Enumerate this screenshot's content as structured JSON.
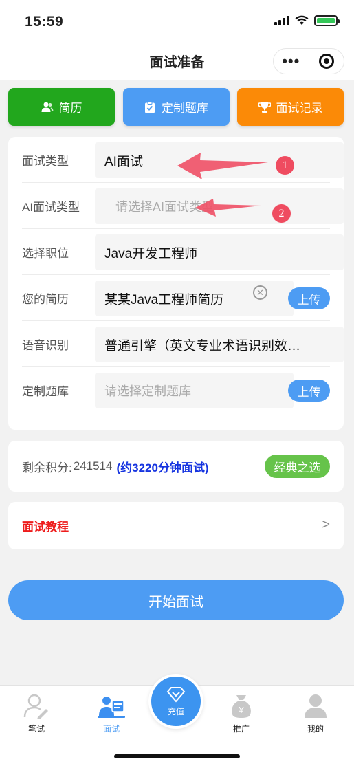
{
  "status": {
    "time": "15:59"
  },
  "nav": {
    "title": "面试准备",
    "more": "•••"
  },
  "top_buttons": [
    {
      "label": "简历",
      "icon": "users-icon"
    },
    {
      "label": "定制题库",
      "icon": "clipboard-icon"
    },
    {
      "label": "面试记录",
      "icon": "trophy-icon"
    }
  ],
  "form": {
    "rows": [
      {
        "label": "面试类型",
        "value": "AI面试",
        "placeholder": false
      },
      {
        "label": "AI面试类型",
        "value": "请选择AI面试类型",
        "placeholder": true
      },
      {
        "label": "选择职位",
        "value": "Java开发工程师",
        "placeholder": false
      },
      {
        "label": "您的简历",
        "value": "某某Java工程师简历",
        "placeholder": false,
        "upload": "上传"
      },
      {
        "label": "语音识别",
        "value": "普通引擎（英文专业术语识别效…",
        "placeholder": false
      },
      {
        "label": "定制题库",
        "value": "请选择定制题库",
        "placeholder": true,
        "upload": "上传"
      }
    ],
    "annotations": [
      "1",
      "2"
    ]
  },
  "points": {
    "label": "剩余积分:",
    "value": "241514",
    "minutes": "(约3220分钟面试)",
    "button": "经典之选"
  },
  "tutorial": {
    "label": "面试教程",
    "chevron": ">"
  },
  "start_button": "开始面试",
  "tabbar": {
    "items": [
      {
        "label": "笔试",
        "icon": "pen-user-icon"
      },
      {
        "label": "面试",
        "icon": "interview-icon",
        "active": true
      },
      {
        "label": "充值",
        "icon": "diamond-icon"
      },
      {
        "label": "推广",
        "icon": "money-bag-icon"
      },
      {
        "label": "我的",
        "icon": "person-icon"
      }
    ]
  },
  "colors": {
    "accent": "#4d9cf3",
    "green": "#22a71d",
    "orange": "#fb8a07",
    "red": "#ee1c1c",
    "annotation": "#ef4c60"
  }
}
